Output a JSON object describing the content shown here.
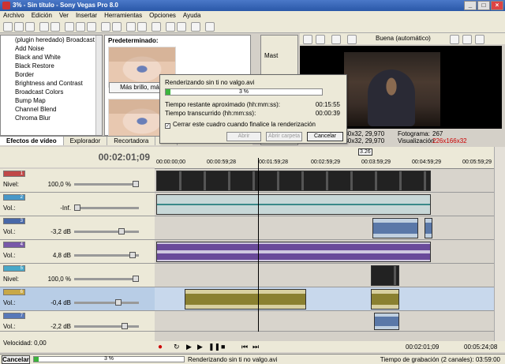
{
  "window": {
    "title": "3% - Sin título - Sony Vegas Pro 8.0"
  },
  "menu": [
    "Archivo",
    "Edición",
    "Ver",
    "Insertar",
    "Herramientas",
    "Opciones",
    "Ayuda"
  ],
  "fx_list": [
    "(plugin heredado) Broadcast Colo",
    "Add Noise",
    "Black and White",
    "Black Restore",
    "Border",
    "Brightness and Contrast",
    "Broadcast Colors",
    "Bump Map",
    "Channel Blend",
    "Chroma Blur"
  ],
  "presets": {
    "header": "Predeterminado:",
    "label": "Más brillo, más"
  },
  "tabs": [
    "Efectos de vídeo",
    "Explorador",
    "Recortadora",
    "Me"
  ],
  "midpanel": {
    "label": "Mast"
  },
  "preview": {
    "quality": "Buena (automático)",
    "res1": "480x32, 29,970",
    "res2": "480x32, 29,970",
    "frame_label": "Fotograma:",
    "frame": "267",
    "display_label": "Visualización:",
    "display": "226x166x32"
  },
  "timeline": {
    "time": "00:02:01;09",
    "ruler": [
      "00:00:00;00",
      "00:00:59;28",
      "00:01:59;28",
      "00:02:59;29",
      "00:03:59;29",
      "00:04:59;29",
      "00:05:59;29"
    ],
    "marker": "3.26"
  },
  "tracks": [
    {
      "num": "1",
      "label": "Nivel:",
      "value": "100,0 %",
      "color": "#c04848",
      "type": "video"
    },
    {
      "num": "2",
      "label": "Vol.:",
      "value": "-Inf.",
      "color": "#4898c8",
      "type": "audio"
    },
    {
      "num": "3",
      "label": "Vol.:",
      "value": "-3,2 dB",
      "color": "#4868a8",
      "type": "audio"
    },
    {
      "num": "4",
      "label": "Vol.:",
      "value": "4,8 dB",
      "color": "#7858a8",
      "type": "audio"
    },
    {
      "num": "5",
      "label": "Nivel:",
      "value": "100,0 %",
      "color": "#48a8c8",
      "type": "video"
    },
    {
      "num": "6",
      "label": "Vol.:",
      "value": "-0,4 dB",
      "color": "#c8a848",
      "type": "audio"
    },
    {
      "num": "7",
      "label": "Vol.:",
      "value": "-2,2 dB",
      "color": "#5878b8",
      "type": "audio"
    }
  ],
  "dialog": {
    "title": "Renderizando sin ti no valgo.avi",
    "progress_pct": 3,
    "progress_text": "3 %",
    "remaining_label": "Tiempo restante aproximado (hh:mm:ss):",
    "remaining": "00:15:55",
    "elapsed_label": "Tiempo transcurrido (hh:mm:ss):",
    "elapsed": "00:00:39",
    "checkbox": "Cerrar este cuadro cuando finalice la renderización",
    "btn_open": "Abrir",
    "btn_folder": "Abrir carpeta",
    "btn_cancel": "Cancelar"
  },
  "bottom": {
    "speed": "Velocidad: 0,00",
    "time1": "00:02:01;09",
    "time2": "00:05:24;08"
  },
  "status": {
    "cancel": "Cancelar",
    "progress_text": "3 %",
    "progress_pct": 3,
    "message": "Renderizando sin ti no valgo.avi",
    "record": "Tiempo de grabación (2 canales): 03:59:00"
  }
}
